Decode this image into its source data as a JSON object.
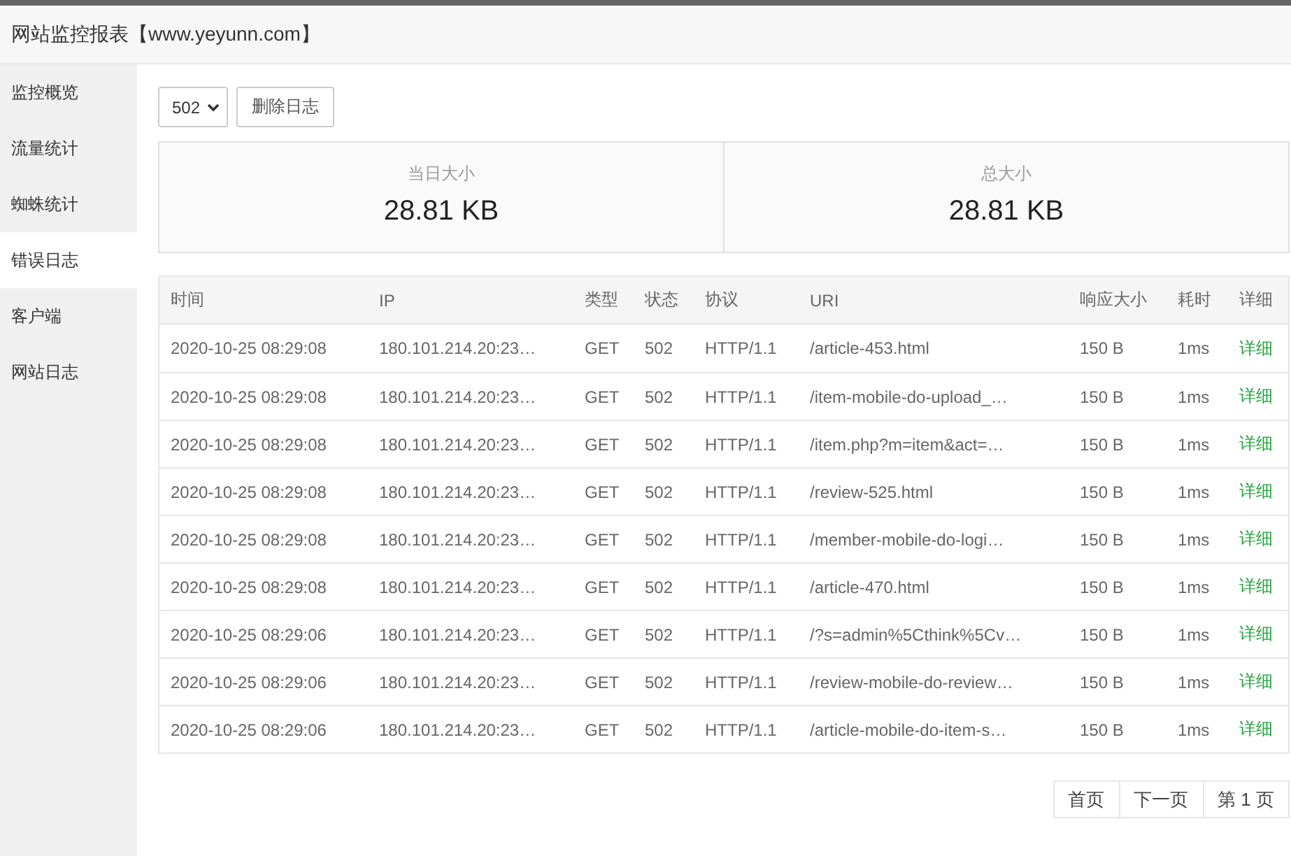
{
  "window": {
    "title": "网站监控报表【www.yeyunn.com】"
  },
  "sidebar": {
    "items": [
      {
        "label": "监控概览",
        "selected": false
      },
      {
        "label": "流量统计",
        "selected": false
      },
      {
        "label": "蜘蛛统计",
        "selected": false
      },
      {
        "label": "错误日志",
        "selected": true
      },
      {
        "label": "客户端",
        "selected": false
      },
      {
        "label": "网站日志",
        "selected": false
      }
    ]
  },
  "toolbar": {
    "status_filter": {
      "value": "502"
    },
    "delete_button": "删除日志"
  },
  "stats": [
    {
      "label": "当日大小",
      "value": "28.81 KB"
    },
    {
      "label": "总大小",
      "value": "28.81 KB"
    }
  ],
  "table": {
    "columns": [
      "时间",
      "IP",
      "类型",
      "状态",
      "协议",
      "URI",
      "响应大小",
      "耗时",
      "详细"
    ],
    "rows": [
      {
        "time": "2020-10-25 08:29:08",
        "ip": "180.101.214.20:23…",
        "type": "GET",
        "status": "502",
        "protocol": "HTTP/1.1",
        "uri": "/article-453.html",
        "size": "150 B",
        "duration": "1ms",
        "detail": "详细"
      },
      {
        "time": "2020-10-25 08:29:08",
        "ip": "180.101.214.20:23…",
        "type": "GET",
        "status": "502",
        "protocol": "HTTP/1.1",
        "uri": "/item-mobile-do-upload_…",
        "size": "150 B",
        "duration": "1ms",
        "detail": "详细"
      },
      {
        "time": "2020-10-25 08:29:08",
        "ip": "180.101.214.20:23…",
        "type": "GET",
        "status": "502",
        "protocol": "HTTP/1.1",
        "uri": "/item.php?m=item&act=…",
        "size": "150 B",
        "duration": "1ms",
        "detail": "详细"
      },
      {
        "time": "2020-10-25 08:29:08",
        "ip": "180.101.214.20:23…",
        "type": "GET",
        "status": "502",
        "protocol": "HTTP/1.1",
        "uri": "/review-525.html",
        "size": "150 B",
        "duration": "1ms",
        "detail": "详细"
      },
      {
        "time": "2020-10-25 08:29:08",
        "ip": "180.101.214.20:23…",
        "type": "GET",
        "status": "502",
        "protocol": "HTTP/1.1",
        "uri": "/member-mobile-do-logi…",
        "size": "150 B",
        "duration": "1ms",
        "detail": "详细"
      },
      {
        "time": "2020-10-25 08:29:08",
        "ip": "180.101.214.20:23…",
        "type": "GET",
        "status": "502",
        "protocol": "HTTP/1.1",
        "uri": "/article-470.html",
        "size": "150 B",
        "duration": "1ms",
        "detail": "详细"
      },
      {
        "time": "2020-10-25 08:29:06",
        "ip": "180.101.214.20:23…",
        "type": "GET",
        "status": "502",
        "protocol": "HTTP/1.1",
        "uri": "/?s=admin%5Cthink%5Cv…",
        "size": "150 B",
        "duration": "1ms",
        "detail": "详细"
      },
      {
        "time": "2020-10-25 08:29:06",
        "ip": "180.101.214.20:23…",
        "type": "GET",
        "status": "502",
        "protocol": "HTTP/1.1",
        "uri": "/review-mobile-do-review…",
        "size": "150 B",
        "duration": "1ms",
        "detail": "详细"
      },
      {
        "time": "2020-10-25 08:29:06",
        "ip": "180.101.214.20:23…",
        "type": "GET",
        "status": "502",
        "protocol": "HTTP/1.1",
        "uri": "/article-mobile-do-item-s…",
        "size": "150 B",
        "duration": "1ms",
        "detail": "详细"
      }
    ]
  },
  "pagination": [
    "首页",
    "下一页",
    "第 1 页"
  ]
}
